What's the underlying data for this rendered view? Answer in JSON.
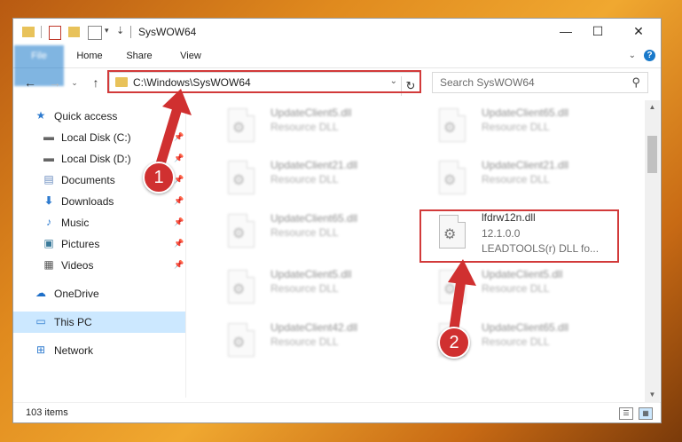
{
  "window": {
    "title": "SysWOW64",
    "controls": {
      "minimize": "—",
      "maximize": "☐",
      "close": "✕"
    }
  },
  "ribbon": {
    "tabs": [
      "File",
      "Home",
      "Share",
      "View"
    ],
    "help": "?"
  },
  "address": {
    "path": "C:\\Windows\\SysWOW64",
    "search_placeholder": "Search SysWOW64"
  },
  "sidebar": {
    "items": [
      {
        "label": "Quick access",
        "icon": "star-icon",
        "pinned": false
      },
      {
        "label": "Local Disk (C:)",
        "icon": "drive-icon",
        "pinned": true
      },
      {
        "label": "Local Disk (D:)",
        "icon": "drive-icon",
        "pinned": true
      },
      {
        "label": "Documents",
        "icon": "document-icon",
        "pinned": true
      },
      {
        "label": "Downloads",
        "icon": "download-icon",
        "pinned": true
      },
      {
        "label": "Music",
        "icon": "music-icon",
        "pinned": true
      },
      {
        "label": "Pictures",
        "icon": "picture-icon",
        "pinned": true
      },
      {
        "label": "Videos",
        "icon": "video-icon",
        "pinned": true
      },
      {
        "label": "OneDrive",
        "icon": "cloud-icon",
        "pinned": false
      },
      {
        "label": "This PC",
        "icon": "computer-icon",
        "pinned": false,
        "selected": true
      },
      {
        "label": "Network",
        "icon": "network-icon",
        "pinned": false
      }
    ]
  },
  "files": [
    {
      "name": "UpdateClient5.dll",
      "type": "Resource DLL"
    },
    {
      "name": "UpdateClient65.dll",
      "type": "Resource DLL"
    },
    {
      "name": "UpdateClient21.dll",
      "type": "Resource DLL"
    },
    {
      "name": "UpdateClient21.dll",
      "type": "Resource DLL"
    },
    {
      "name": "UpdateClient65.dll",
      "type": "Resource DLL"
    },
    {
      "name": "lfdrw12n.dll",
      "version": "12.1.0.0",
      "type": "LEADTOOLS(r) DLL fo...",
      "highlighted": true
    },
    {
      "name": "UpdateClient5.dll",
      "type": "Resource DLL"
    },
    {
      "name": "UpdateClient5.dll",
      "type": "Resource DLL"
    },
    {
      "name": "UpdateClient42.dll",
      "type": "Resource DLL"
    },
    {
      "name": "UpdateClient65.dll",
      "type": "Resource DLL"
    }
  ],
  "status": {
    "item_count": "103 items"
  },
  "annotations": {
    "step1": "1",
    "step2": "2",
    "color": "#d03030"
  }
}
